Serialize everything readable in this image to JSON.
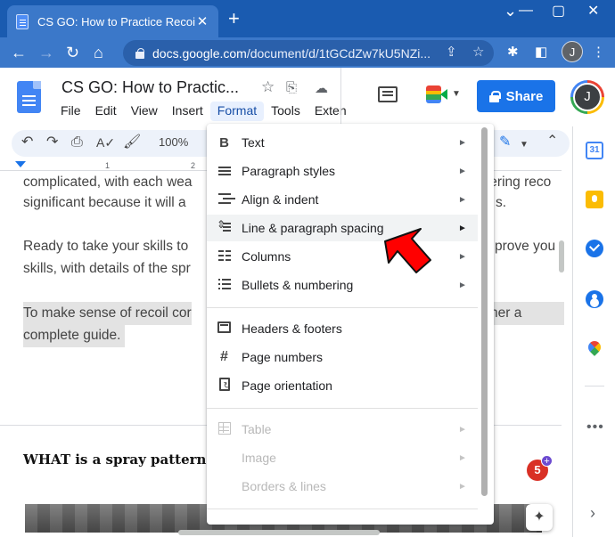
{
  "browser": {
    "tab_title": "CS GO: How to Practice Recoil Co",
    "tab_close": "✕",
    "new_tab": "+",
    "url_host": "docs.google.com",
    "url_path": "/document/d/1tGCdZw7kU5NZi...",
    "profile_initial": "J"
  },
  "docs": {
    "title": "CS GO: How to Practic...",
    "menu": [
      "File",
      "Edit",
      "View",
      "Insert",
      "Format",
      "Tools",
      "Exten"
    ],
    "active_menu_index": 4,
    "share_label": "Share",
    "user_initial": "J",
    "zoom": "100%",
    "calendar_day": "31"
  },
  "ruler": [
    "1",
    "2"
  ],
  "body": {
    "p1_line1": "complicated, with each wea",
    "p1_line1_end": "tering reco",
    "p1_line2": "significant because it will a",
    "p1_line2_end": "s.",
    "p2_line1": "Ready to take your skills to",
    "p2_line1_end": "prove you",
    "p2_line2": "skills, with details of the spr",
    "p3_line1": "To make sense of recoil cor",
    "p3_line1_end": "her a",
    "p3_line2": "complete guide.",
    "heading": "WHAT is a spray pattern"
  },
  "notifications_count": "5",
  "format_menu": {
    "items": [
      {
        "label": "Text",
        "submenu": true
      },
      {
        "label": "Paragraph styles",
        "submenu": true
      },
      {
        "label": "Align & indent",
        "submenu": true
      },
      {
        "label": "Line & paragraph spacing",
        "submenu": true
      },
      {
        "label": "Columns",
        "submenu": true
      },
      {
        "label": "Bullets & numbering",
        "submenu": true
      },
      {
        "label": "Headers & footers",
        "submenu": false
      },
      {
        "label": "Page numbers",
        "submenu": false
      },
      {
        "label": "Page orientation",
        "submenu": false
      },
      {
        "label": "Table",
        "submenu": true,
        "disabled": true
      },
      {
        "label": "Image",
        "submenu": true,
        "disabled": true
      },
      {
        "label": "Borders & lines",
        "submenu": true,
        "disabled": true
      }
    ],
    "highlighted_index": 3,
    "arrow_glyph": "►"
  },
  "colors": {
    "chrome_titlebar": "#1a5bb0",
    "chrome_toolbar": "#3b78c9",
    "share_blue": "#1a73e8",
    "highlight_arrow": "#ff0000"
  }
}
